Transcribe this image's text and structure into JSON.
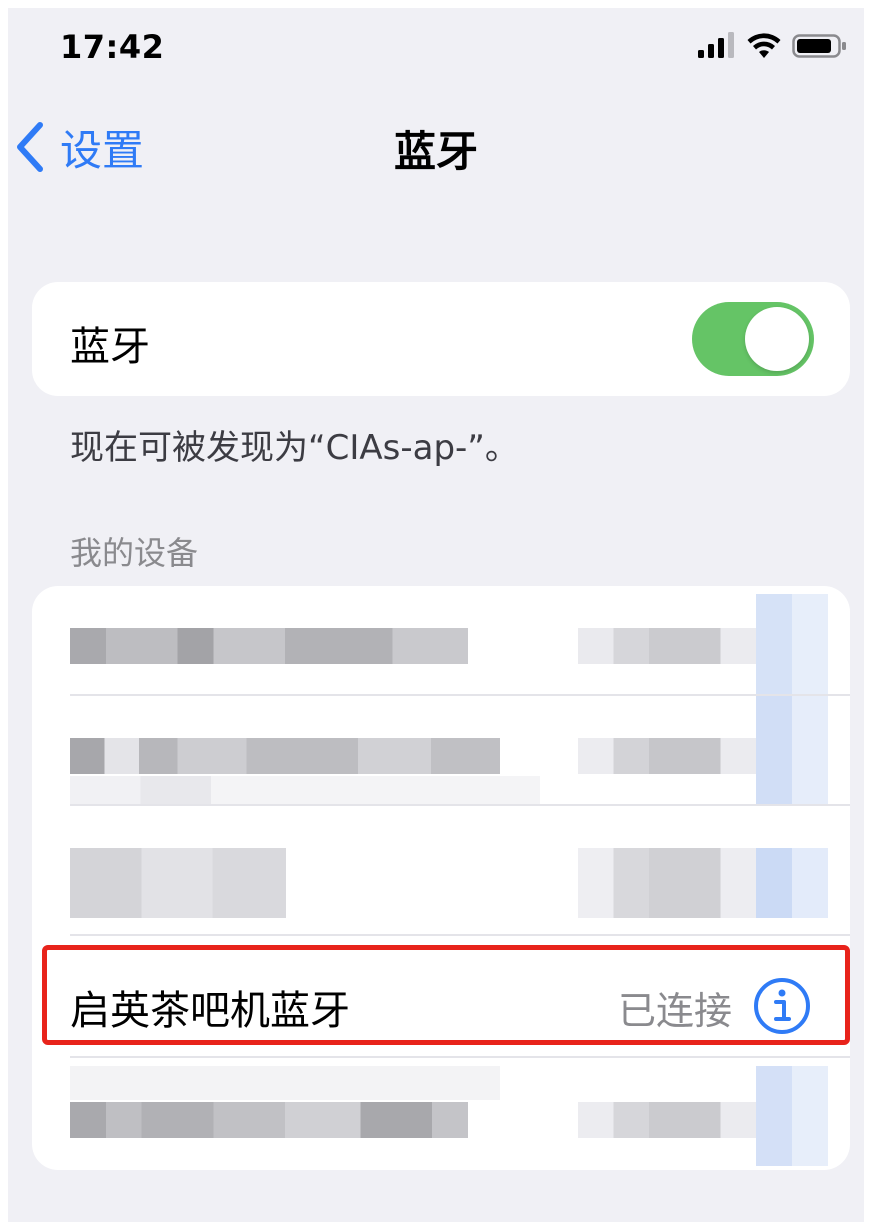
{
  "status_bar": {
    "time": "17:42"
  },
  "nav": {
    "back_label": "设置",
    "title": "蓝牙"
  },
  "bluetooth": {
    "label": "蓝牙",
    "enabled": true,
    "discoverable_text": "现在可被发现为“CIAs-ap-”。"
  },
  "my_devices": {
    "header": "我的设备",
    "connected_device": {
      "name": "启英茶吧机蓝牙",
      "status": "已连接"
    }
  },
  "colors": {
    "accent": "#2f7bf6",
    "switch_on": "#65c466",
    "highlight": "#e8231b",
    "background": "#f0f0f5"
  }
}
